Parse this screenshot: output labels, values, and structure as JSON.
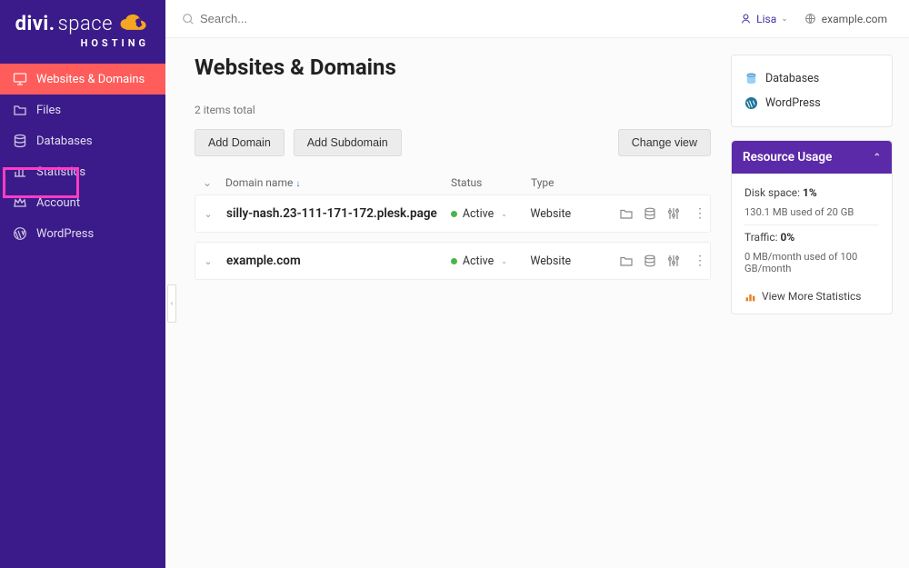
{
  "logo": {
    "part1": "divi.",
    "part2": "space",
    "sub": "HOSTING"
  },
  "search": {
    "placeholder": "Search..."
  },
  "topbar": {
    "user": "Lisa",
    "domain": "example.com"
  },
  "sidebar": {
    "items": [
      {
        "label": "Websites & Domains"
      },
      {
        "label": "Files"
      },
      {
        "label": "Databases"
      },
      {
        "label": "Statistics"
      },
      {
        "label": "Account"
      },
      {
        "label": "WordPress"
      }
    ]
  },
  "page": {
    "title": "Websites & Domains",
    "items_total": "2 items total",
    "btn_add_domain": "Add Domain",
    "btn_add_sub": "Add Subdomain",
    "btn_change_view": "Change view",
    "columns": {
      "name": "Domain name",
      "status": "Status",
      "type": "Type"
    },
    "rows": [
      {
        "name": "silly-nash.23-111-171-172.plesk.page",
        "status": "Active",
        "type": "Website"
      },
      {
        "name": "example.com",
        "status": "Active",
        "type": "Website"
      }
    ]
  },
  "quicklinks": {
    "databases": "Databases",
    "wordpress": "WordPress"
  },
  "resource": {
    "title": "Resource Usage",
    "disk_label": "Disk space: ",
    "disk_pct": "1%",
    "disk_sub": "130.1 MB used of 20 GB",
    "traffic_label": "Traffic: ",
    "traffic_pct": "0%",
    "traffic_sub": "0 MB/month used of 100 GB/month",
    "view_more": "View More Statistics"
  }
}
